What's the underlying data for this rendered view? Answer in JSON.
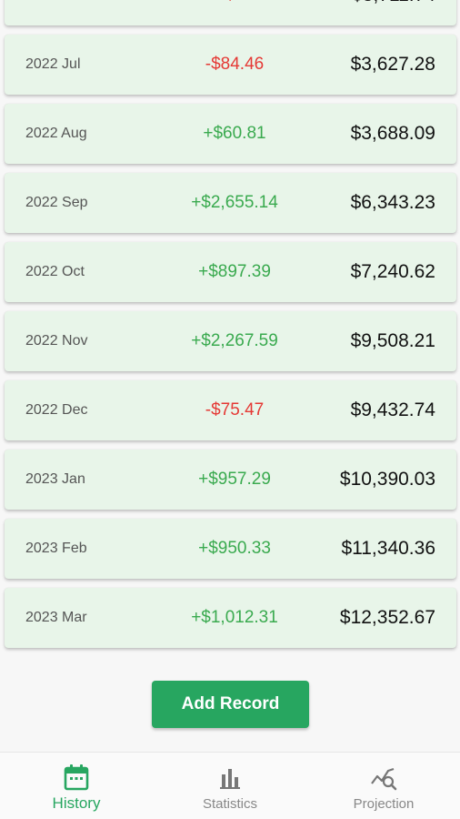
{
  "records": [
    {
      "date": "",
      "change": "+$/... ",
      "change_sign": "pos",
      "balance": "$3,711.74"
    },
    {
      "date": "2022 Jul",
      "change": "-$84.46",
      "change_sign": "neg",
      "balance": "$3,627.28"
    },
    {
      "date": "2022 Aug",
      "change": "+$60.81",
      "change_sign": "pos",
      "balance": "$3,688.09"
    },
    {
      "date": "2022 Sep",
      "change": "+$2,655.14",
      "change_sign": "pos",
      "balance": "$6,343.23"
    },
    {
      "date": "2022 Oct",
      "change": "+$897.39",
      "change_sign": "pos",
      "balance": "$7,240.62"
    },
    {
      "date": "2022 Nov",
      "change": "+$2,267.59",
      "change_sign": "pos",
      "balance": "$9,508.21"
    },
    {
      "date": "2022 Dec",
      "change": "-$75.47",
      "change_sign": "neg",
      "balance": "$9,432.74"
    },
    {
      "date": "2023 Jan",
      "change": "+$957.29",
      "change_sign": "pos",
      "balance": "$10,390.03"
    },
    {
      "date": "2023 Feb",
      "change": "+$950.33",
      "change_sign": "pos",
      "balance": "$11,340.36"
    },
    {
      "date": "2023 Mar",
      "change": "+$1,012.31",
      "change_sign": "pos",
      "balance": "$12,352.67"
    }
  ],
  "add_button": {
    "label": "Add Record"
  },
  "nav": {
    "items": [
      {
        "label": "History",
        "icon": "calendar-icon",
        "active": true
      },
      {
        "label": "Statistics",
        "icon": "bar-chart-icon",
        "active": false
      },
      {
        "label": "Projection",
        "icon": "trend-search-icon",
        "active": false
      }
    ]
  },
  "colors": {
    "accent": "#27a660",
    "card_bg": "#e8f5e9",
    "positive": "#3aaa4f",
    "negative": "#e53935"
  }
}
